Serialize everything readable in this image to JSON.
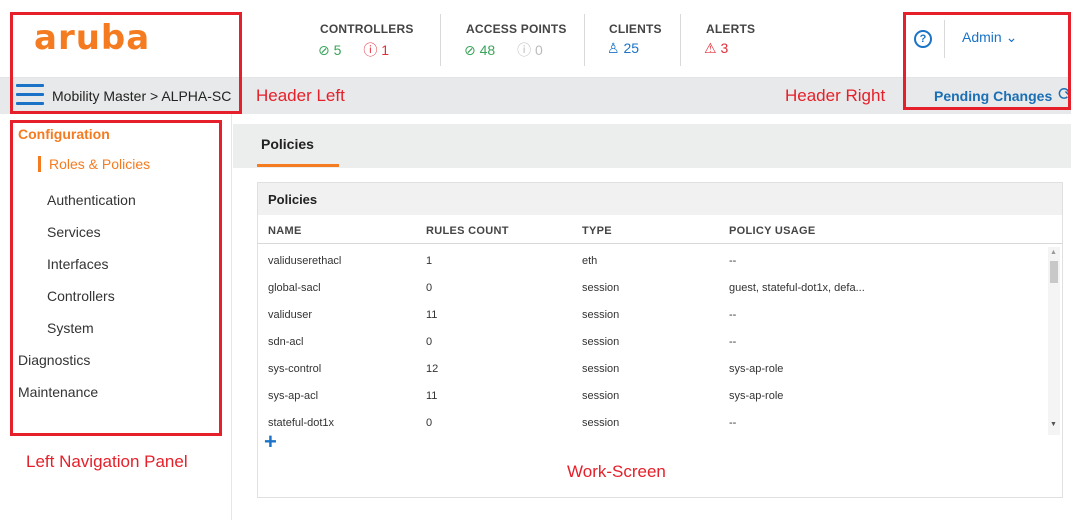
{
  "brand": {
    "logo": "aruba"
  },
  "header": {
    "stats": [
      {
        "title": "CONTROLLERS",
        "items": [
          {
            "icon": "check-circle-icon",
            "value": "5",
            "tone": "green"
          },
          {
            "icon": "alert-circle-icon",
            "value": "1",
            "tone": "red"
          }
        ]
      },
      {
        "title": "ACCESS POINTS",
        "items": [
          {
            "icon": "check-circle-icon",
            "value": "48",
            "tone": "green"
          },
          {
            "icon": "alert-circle-icon",
            "value": "0",
            "tone": "grey"
          }
        ]
      },
      {
        "title": "CLIENTS",
        "items": [
          {
            "icon": "users-icon",
            "value": "25",
            "tone": "blue"
          }
        ]
      },
      {
        "title": "ALERTS",
        "items": [
          {
            "icon": "warning-triangle-icon",
            "value": "3",
            "tone": "red"
          }
        ]
      }
    ],
    "help_icon": "?",
    "user": "Admin",
    "breadcrumb": "Mobility Master > ALPHA-SC",
    "pending_changes": "Pending Changes"
  },
  "nav": {
    "configuration": "Configuration",
    "items": [
      "Roles & Policies",
      "Authentication",
      "Services",
      "Interfaces",
      "Controllers",
      "System"
    ],
    "diagnostics": "Diagnostics",
    "maintenance": "Maintenance"
  },
  "main": {
    "tab": "Policies",
    "card_title": "Policies",
    "columns": [
      "NAME",
      "RULES COUNT",
      "TYPE",
      "POLICY USAGE"
    ],
    "rows": [
      [
        "validuserethacl",
        "1",
        "eth",
        "--"
      ],
      [
        "global-sacl",
        "0",
        "session",
        "guest, stateful-dot1x, defa..."
      ],
      [
        "validuser",
        "11",
        "session",
        "--"
      ],
      [
        "sdn-acl",
        "0",
        "session",
        "--"
      ],
      [
        "sys-control",
        "12",
        "session",
        "sys-ap-role"
      ],
      [
        "sys-ap-acl",
        "11",
        "session",
        "sys-ap-role"
      ],
      [
        "stateful-dot1x",
        "0",
        "session",
        "--"
      ]
    ],
    "add_label": "+"
  },
  "annotations": {
    "header_left": "Header Left",
    "header_right": "Header Right",
    "left_nav": "Left Navigation Panel",
    "work_screen": "Work-Screen"
  },
  "colors": {
    "accent": "#f47b20",
    "link": "#1a73c6",
    "annotation": "#e5202a"
  }
}
